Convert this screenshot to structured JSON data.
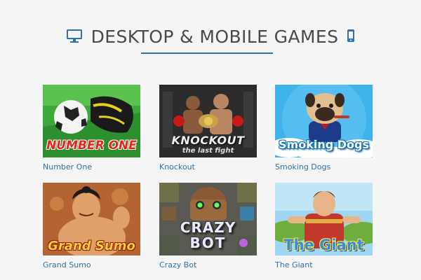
{
  "section": {
    "title": "DESKTOP & MOBILE GAMES",
    "title_icon_left": "desktop-monitor-icon",
    "title_icon_right": "mobile-phone-icon",
    "accent_color": "#2f73ab",
    "label_color": "#2f6fa6",
    "text_color": "#4a4a4a"
  },
  "games": [
    {
      "name": "Number One",
      "thumb_text": "NUMBER ONE"
    },
    {
      "name": "Knockout",
      "thumb_text": "KNOCKOUT",
      "thumb_subtext": "the last fight"
    },
    {
      "name": "Smoking Dogs",
      "thumb_text": "Smoking Dogs"
    },
    {
      "name": "Grand Sumo",
      "thumb_text": "Grand Sumo"
    },
    {
      "name": "Crazy Bot",
      "thumb_text": "CRAZY",
      "thumb_subtext": "BOT"
    },
    {
      "name": "The Giant",
      "thumb_text": "The Giant"
    }
  ]
}
